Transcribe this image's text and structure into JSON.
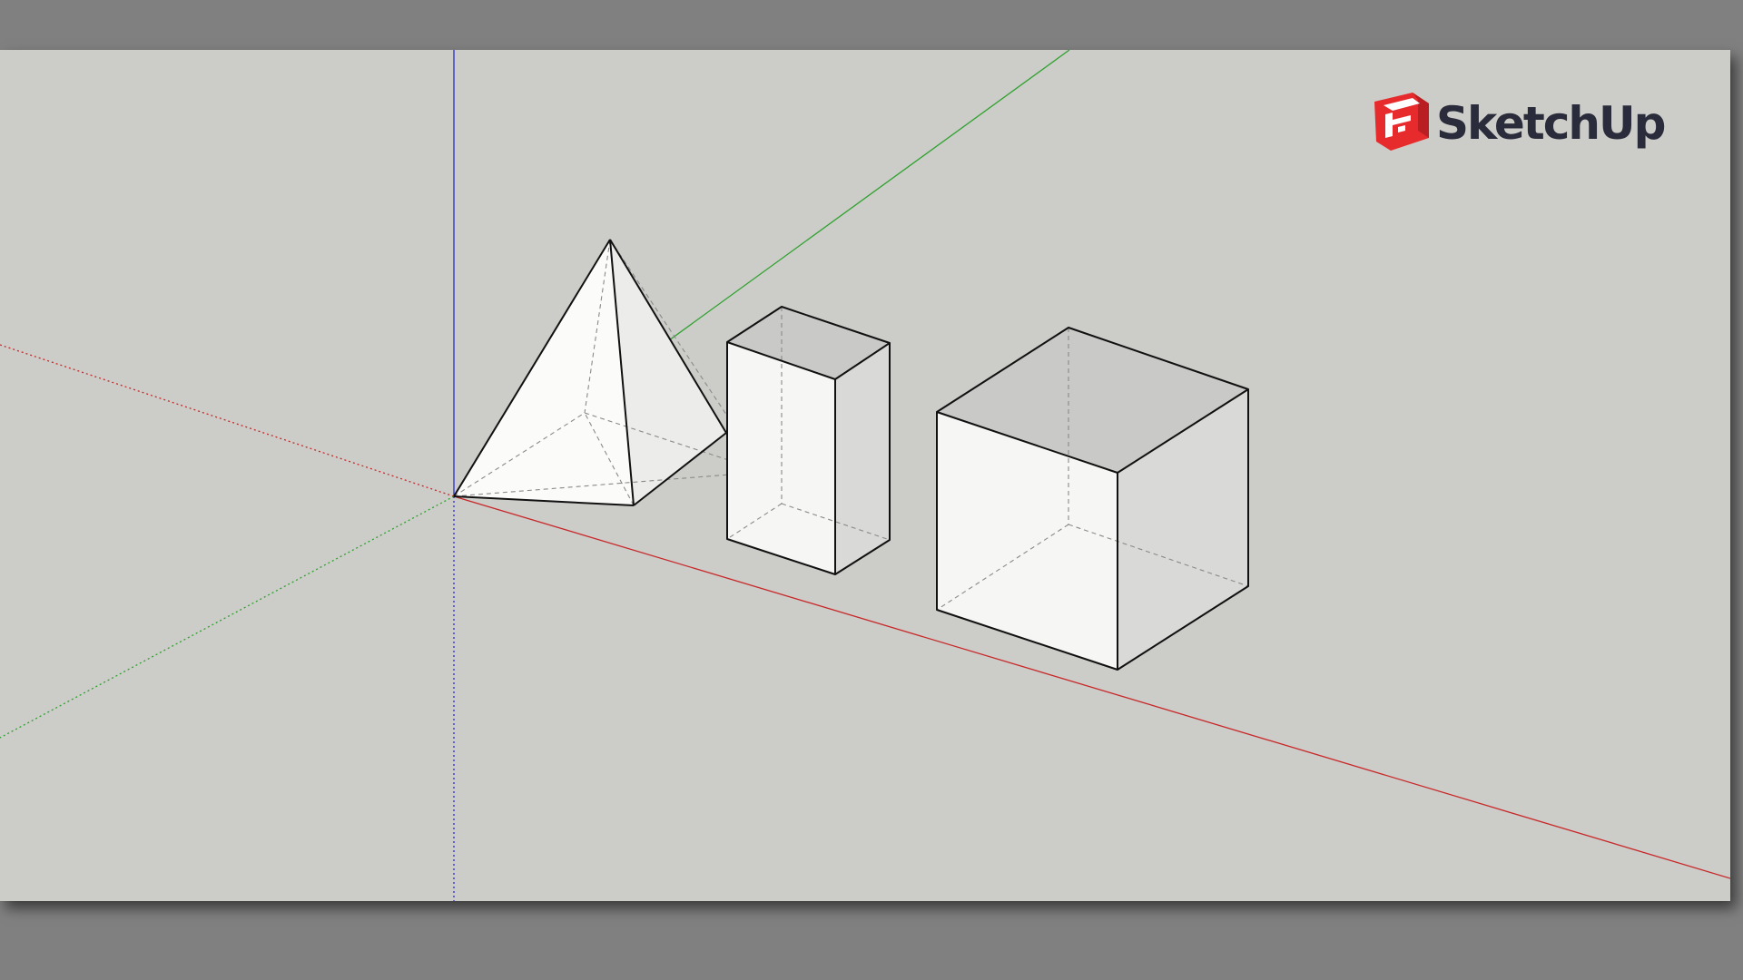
{
  "app": {
    "brand_name": "SketchUp",
    "brand_icon": "sketchup-logo-icon",
    "colors": {
      "outer_background": "#808080",
      "viewport_background": "#cccdc8",
      "x_axis_red": "#c8282a",
      "y_axis_green": "#2fa12f",
      "z_axis_blue": "#2a2ad0",
      "edge_black": "#111111",
      "hidden_edge_gray": "#8a8a8a",
      "brand_red": "#e72b2d",
      "brand_text": "#2b2c3b"
    }
  },
  "scene": {
    "view_style": "X-ray with hidden edges",
    "axes": [
      {
        "name": "red-axis",
        "color": "#c8282a"
      },
      {
        "name": "green-axis",
        "color": "#2fa12f"
      },
      {
        "name": "blue-axis",
        "color": "#2a2ad0"
      }
    ],
    "objects": [
      {
        "name": "pyramid",
        "shape": "square pyramid"
      },
      {
        "name": "rectangular-box",
        "shape": "tall box"
      },
      {
        "name": "cube",
        "shape": "cube"
      }
    ]
  }
}
